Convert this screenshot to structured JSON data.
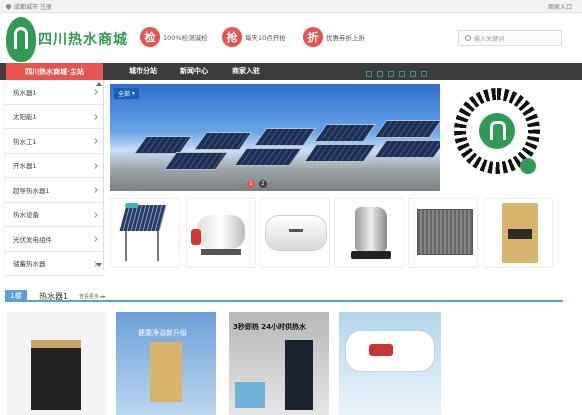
{
  "topbar": {
    "location": "成都城市 注册",
    "entry": "商家入口"
  },
  "logo": {
    "text": "四川热水商城"
  },
  "features": [
    {
      "icon_char": "检",
      "text": "100%检测诚检"
    },
    {
      "icon_char": "抢",
      "text": "每天10点开抢"
    },
    {
      "icon_char": "折",
      "text": "优惠券折上折"
    }
  ],
  "search": {
    "placeholder": "输入关键词"
  },
  "nav": {
    "all_label": "四川热水商城·主站",
    "items": [
      "城市分站",
      "新闻中心",
      "商家入驻"
    ]
  },
  "sidebar": {
    "items": [
      "热水器1",
      "太阳能1",
      "热水工1",
      "开水器1",
      "超导热水器1",
      "热水设备",
      "光伏发电组件",
      "储蓄热水器"
    ]
  },
  "banner": {
    "select_label": "全部",
    "dot1": "1",
    "dot2": "2"
  },
  "floor": {
    "number": "1楼",
    "name": "热水器1",
    "more": "查看更多 ▸▸"
  },
  "cards": {
    "c2_line1": "健康净浴新升级",
    "c3_line1": "3秒即热 24小时供热水"
  },
  "colors": {
    "accent": "#e8534f",
    "brand": "#2f9a55",
    "nav": "#3c3c3c",
    "floor": "#5aa0e0"
  }
}
